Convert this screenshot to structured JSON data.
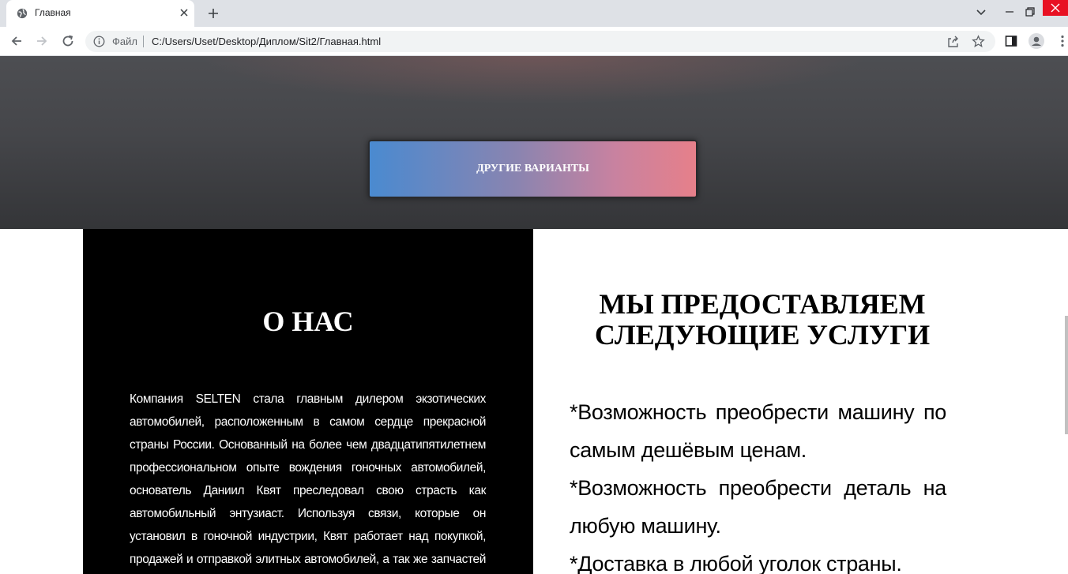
{
  "browser": {
    "tab_title": "Главная",
    "omnibox_file_label": "Файл",
    "url": "C:/Users/Uset/Desktop/Диплом/Sit2/Главная.html"
  },
  "hero": {
    "button_label": "ДРУГИЕ ВАРИАНТЫ"
  },
  "about": {
    "title": "О НАС",
    "text": "Компания SELTEN стала главным дилером экзотических автомобилей, расположенным в самом сердце прекрасной страны России. Основанный на более чем двадцатипятилетнем профессиональном опыте вождения гоночных автомобилей, основатель Даниил Квят преследовал свою страсть как автомобильный энтузиаст. Используя связи, которые он установил в гоночной индустрии, Квят работает над покупкой, продажей и отправкой элитных автомобилей, а так же запчастей на них по"
  },
  "services": {
    "title": "МЫ ПРЕДОСТАВЛЯЕМ СЛЕДУЮЩИЕ УСЛУГИ",
    "items": [
      "*Возможность преобрести машину по самым дешёвым ценам.",
      "*Возможность преобрести деталь на любую машину.",
      "*Доставка в любой уголок страны."
    ]
  }
}
